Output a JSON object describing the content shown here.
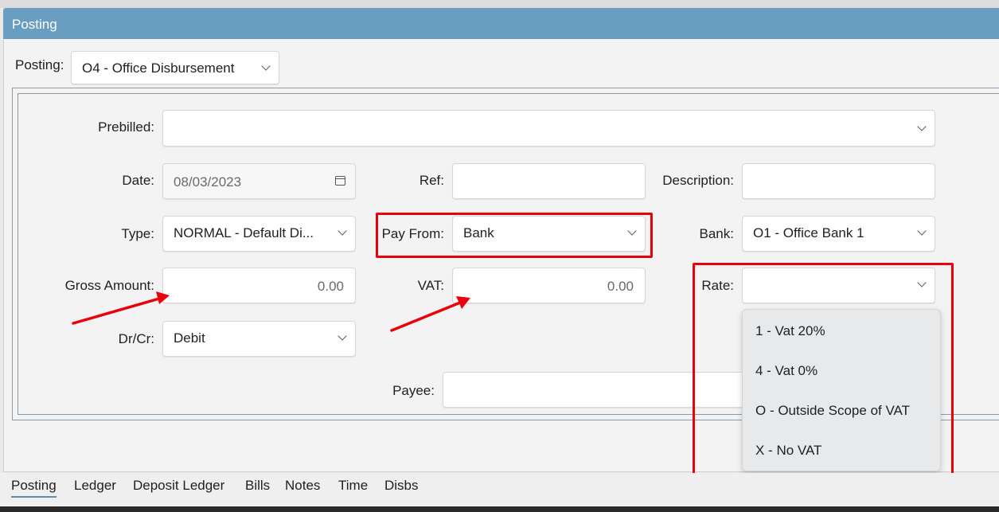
{
  "window": {
    "title": "Posting"
  },
  "posting": {
    "label": "Posting:",
    "value": "O4 - Office Disbursement"
  },
  "form": {
    "prebilled": {
      "label": "Prebilled:",
      "value": ""
    },
    "date": {
      "label": "Date:",
      "value": "08/03/2023"
    },
    "ref": {
      "label": "Ref:",
      "value": ""
    },
    "description": {
      "label": "Description:",
      "value": ""
    },
    "type": {
      "label": "Type:",
      "value": "NORMAL - Default Di..."
    },
    "pay_from": {
      "label": "Pay From:",
      "value": "Bank"
    },
    "bank": {
      "label": "Bank:",
      "value": "O1 - Office Bank 1"
    },
    "gross_amount": {
      "label": "Gross Amount:",
      "value": "0.00"
    },
    "vat": {
      "label": "VAT:",
      "value": "0.00"
    },
    "rate": {
      "label": "Rate:",
      "value": ""
    },
    "dr_cr": {
      "label": "Dr/Cr:",
      "value": "Debit"
    },
    "payee": {
      "label": "Payee:",
      "value": ""
    }
  },
  "rate_options": [
    "1 - Vat 20%",
    "4 - Vat 0%",
    "O - Outside Scope of VAT",
    "X - No VAT"
  ],
  "tabs": [
    "Posting",
    "Ledger",
    "Deposit Ledger",
    "Bills",
    "Notes",
    "Time",
    "Disbs"
  ],
  "colors": {
    "titlebar": "#6a9ec0",
    "annotation": "#e8000b",
    "active_tab_underline": "#5b8db8"
  }
}
